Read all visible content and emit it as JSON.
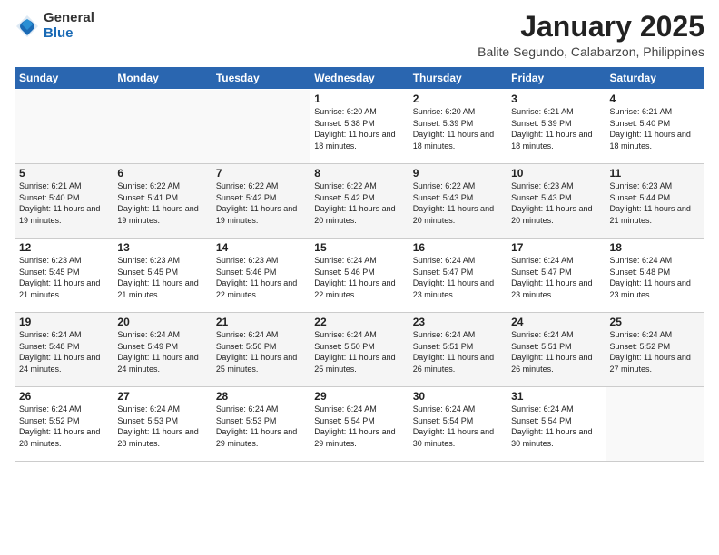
{
  "header": {
    "logo_general": "General",
    "logo_blue": "Blue",
    "month": "January 2025",
    "location": "Balite Segundo, Calabarzon, Philippines"
  },
  "days_of_week": [
    "Sunday",
    "Monday",
    "Tuesday",
    "Wednesday",
    "Thursday",
    "Friday",
    "Saturday"
  ],
  "weeks": [
    [
      {
        "day": "",
        "sunrise": "",
        "sunset": "",
        "daylight": ""
      },
      {
        "day": "",
        "sunrise": "",
        "sunset": "",
        "daylight": ""
      },
      {
        "day": "",
        "sunrise": "",
        "sunset": "",
        "daylight": ""
      },
      {
        "day": "1",
        "sunrise": "Sunrise: 6:20 AM",
        "sunset": "Sunset: 5:38 PM",
        "daylight": "Daylight: 11 hours and 18 minutes."
      },
      {
        "day": "2",
        "sunrise": "Sunrise: 6:20 AM",
        "sunset": "Sunset: 5:39 PM",
        "daylight": "Daylight: 11 hours and 18 minutes."
      },
      {
        "day": "3",
        "sunrise": "Sunrise: 6:21 AM",
        "sunset": "Sunset: 5:39 PM",
        "daylight": "Daylight: 11 hours and 18 minutes."
      },
      {
        "day": "4",
        "sunrise": "Sunrise: 6:21 AM",
        "sunset": "Sunset: 5:40 PM",
        "daylight": "Daylight: 11 hours and 18 minutes."
      }
    ],
    [
      {
        "day": "5",
        "sunrise": "Sunrise: 6:21 AM",
        "sunset": "Sunset: 5:40 PM",
        "daylight": "Daylight: 11 hours and 19 minutes."
      },
      {
        "day": "6",
        "sunrise": "Sunrise: 6:22 AM",
        "sunset": "Sunset: 5:41 PM",
        "daylight": "Daylight: 11 hours and 19 minutes."
      },
      {
        "day": "7",
        "sunrise": "Sunrise: 6:22 AM",
        "sunset": "Sunset: 5:42 PM",
        "daylight": "Daylight: 11 hours and 19 minutes."
      },
      {
        "day": "8",
        "sunrise": "Sunrise: 6:22 AM",
        "sunset": "Sunset: 5:42 PM",
        "daylight": "Daylight: 11 hours and 20 minutes."
      },
      {
        "day": "9",
        "sunrise": "Sunrise: 6:22 AM",
        "sunset": "Sunset: 5:43 PM",
        "daylight": "Daylight: 11 hours and 20 minutes."
      },
      {
        "day": "10",
        "sunrise": "Sunrise: 6:23 AM",
        "sunset": "Sunset: 5:43 PM",
        "daylight": "Daylight: 11 hours and 20 minutes."
      },
      {
        "day": "11",
        "sunrise": "Sunrise: 6:23 AM",
        "sunset": "Sunset: 5:44 PM",
        "daylight": "Daylight: 11 hours and 21 minutes."
      }
    ],
    [
      {
        "day": "12",
        "sunrise": "Sunrise: 6:23 AM",
        "sunset": "Sunset: 5:45 PM",
        "daylight": "Daylight: 11 hours and 21 minutes."
      },
      {
        "day": "13",
        "sunrise": "Sunrise: 6:23 AM",
        "sunset": "Sunset: 5:45 PM",
        "daylight": "Daylight: 11 hours and 21 minutes."
      },
      {
        "day": "14",
        "sunrise": "Sunrise: 6:23 AM",
        "sunset": "Sunset: 5:46 PM",
        "daylight": "Daylight: 11 hours and 22 minutes."
      },
      {
        "day": "15",
        "sunrise": "Sunrise: 6:24 AM",
        "sunset": "Sunset: 5:46 PM",
        "daylight": "Daylight: 11 hours and 22 minutes."
      },
      {
        "day": "16",
        "sunrise": "Sunrise: 6:24 AM",
        "sunset": "Sunset: 5:47 PM",
        "daylight": "Daylight: 11 hours and 23 minutes."
      },
      {
        "day": "17",
        "sunrise": "Sunrise: 6:24 AM",
        "sunset": "Sunset: 5:47 PM",
        "daylight": "Daylight: 11 hours and 23 minutes."
      },
      {
        "day": "18",
        "sunrise": "Sunrise: 6:24 AM",
        "sunset": "Sunset: 5:48 PM",
        "daylight": "Daylight: 11 hours and 23 minutes."
      }
    ],
    [
      {
        "day": "19",
        "sunrise": "Sunrise: 6:24 AM",
        "sunset": "Sunset: 5:48 PM",
        "daylight": "Daylight: 11 hours and 24 minutes."
      },
      {
        "day": "20",
        "sunrise": "Sunrise: 6:24 AM",
        "sunset": "Sunset: 5:49 PM",
        "daylight": "Daylight: 11 hours and 24 minutes."
      },
      {
        "day": "21",
        "sunrise": "Sunrise: 6:24 AM",
        "sunset": "Sunset: 5:50 PM",
        "daylight": "Daylight: 11 hours and 25 minutes."
      },
      {
        "day": "22",
        "sunrise": "Sunrise: 6:24 AM",
        "sunset": "Sunset: 5:50 PM",
        "daylight": "Daylight: 11 hours and 25 minutes."
      },
      {
        "day": "23",
        "sunrise": "Sunrise: 6:24 AM",
        "sunset": "Sunset: 5:51 PM",
        "daylight": "Daylight: 11 hours and 26 minutes."
      },
      {
        "day": "24",
        "sunrise": "Sunrise: 6:24 AM",
        "sunset": "Sunset: 5:51 PM",
        "daylight": "Daylight: 11 hours and 26 minutes."
      },
      {
        "day": "25",
        "sunrise": "Sunrise: 6:24 AM",
        "sunset": "Sunset: 5:52 PM",
        "daylight": "Daylight: 11 hours and 27 minutes."
      }
    ],
    [
      {
        "day": "26",
        "sunrise": "Sunrise: 6:24 AM",
        "sunset": "Sunset: 5:52 PM",
        "daylight": "Daylight: 11 hours and 28 minutes."
      },
      {
        "day": "27",
        "sunrise": "Sunrise: 6:24 AM",
        "sunset": "Sunset: 5:53 PM",
        "daylight": "Daylight: 11 hours and 28 minutes."
      },
      {
        "day": "28",
        "sunrise": "Sunrise: 6:24 AM",
        "sunset": "Sunset: 5:53 PM",
        "daylight": "Daylight: 11 hours and 29 minutes."
      },
      {
        "day": "29",
        "sunrise": "Sunrise: 6:24 AM",
        "sunset": "Sunset: 5:54 PM",
        "daylight": "Daylight: 11 hours and 29 minutes."
      },
      {
        "day": "30",
        "sunrise": "Sunrise: 6:24 AM",
        "sunset": "Sunset: 5:54 PM",
        "daylight": "Daylight: 11 hours and 30 minutes."
      },
      {
        "day": "31",
        "sunrise": "Sunrise: 6:24 AM",
        "sunset": "Sunset: 5:54 PM",
        "daylight": "Daylight: 11 hours and 30 minutes."
      },
      {
        "day": "",
        "sunrise": "",
        "sunset": "",
        "daylight": ""
      }
    ]
  ]
}
